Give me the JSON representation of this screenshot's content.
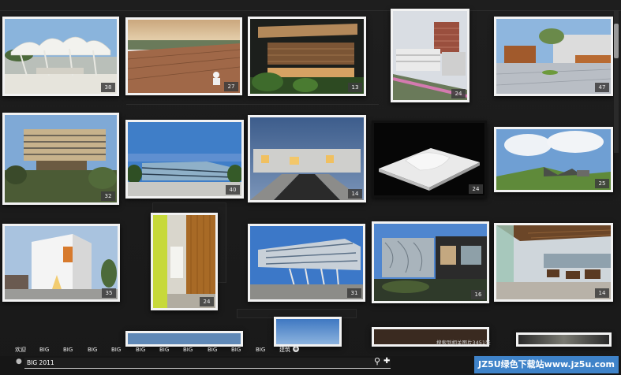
{
  "gallery": {
    "tiles": [
      {
        "name": "tile-canopy-pavilion",
        "count": "38"
      },
      {
        "name": "tile-rooftop-deck",
        "count": "27"
      },
      {
        "name": "tile-wood-facade-night",
        "count": "13"
      },
      {
        "name": "tile-campus-buildings",
        "count": "24"
      },
      {
        "name": "tile-courtyard-plaza",
        "count": "47"
      },
      {
        "name": "tile-stacked-box-building",
        "count": "32"
      },
      {
        "name": "tile-glass-office",
        "count": "40"
      },
      {
        "name": "tile-terrace-housing",
        "count": "14"
      },
      {
        "name": "tile-white-model",
        "count": "24"
      },
      {
        "name": "tile-green-roof-landscape",
        "count": "25"
      },
      {
        "name": "tile-white-cube-house",
        "count": "35"
      },
      {
        "name": "tile-interior-wood-wall",
        "count": "24"
      },
      {
        "name": "tile-cantilever-building",
        "count": "31"
      },
      {
        "name": "tile-mesh-facade-street",
        "count": "16"
      },
      {
        "name": "tile-restaurant-terrace",
        "count": "14"
      }
    ]
  },
  "tagbar": {
    "tags": [
      "欢迎",
      "BIG",
      "BIG",
      "BIG",
      "BIG",
      "BIG",
      "BIG",
      "BIG",
      "BIG",
      "BIG",
      "BIG",
      "BIG"
    ],
    "category": "建筑",
    "add_symbol": "+"
  },
  "search": {
    "value": "BIG 2011",
    "search_glyph": "⚲",
    "add_glyph": "✚",
    "result_text": "搜索到相关图片3451张"
  },
  "watermark": {
    "text": "JZ5U绿色下载站www.jz5u.com"
  }
}
